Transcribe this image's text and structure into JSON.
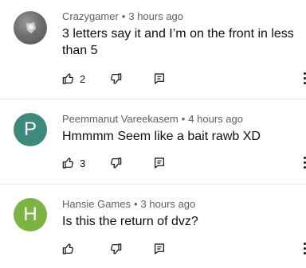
{
  "comments": [
    {
      "author": "Crazygamer",
      "time": "3 hours ago",
      "text": "3 letters say it and I’m on the front in less than 5",
      "likes": "2",
      "avatar_letter": "",
      "avatar_color": "#707070"
    },
    {
      "author": "Peemmanut Vareekasem",
      "time": "4 hours ago",
      "text": "Hmmmm Seem like a bait rawb XD",
      "likes": "3",
      "avatar_letter": "P",
      "avatar_color": "#3d8a7d"
    },
    {
      "author": "Hansie Games",
      "time": "3 hours ago",
      "text": "Is this the return of dvz?",
      "likes": "",
      "avatar_letter": "H",
      "avatar_color": "#7cb342"
    }
  ],
  "meta_separator": "•",
  "icons": {
    "like": "thumb-up-icon",
    "dislike": "thumb-down-icon",
    "reply": "reply-icon",
    "more": "more-vert-icon"
  }
}
